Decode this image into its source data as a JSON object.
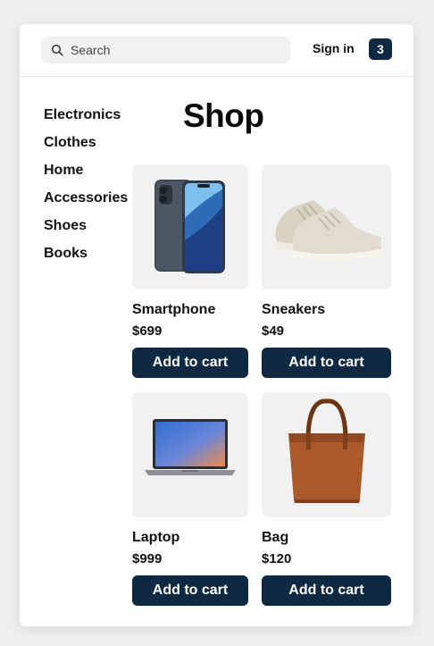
{
  "header": {
    "search": {
      "placeholder": "Search",
      "icon": "search-icon"
    },
    "signin_label": "Sign in",
    "cart_count": "3"
  },
  "page": {
    "title": "Shop"
  },
  "sidebar": {
    "categories": [
      {
        "label": "Electronics"
      },
      {
        "label": "Clothes"
      },
      {
        "label": "Home"
      },
      {
        "label": "Accessories"
      },
      {
        "label": "Shoes"
      },
      {
        "label": "Books"
      }
    ]
  },
  "products": [
    {
      "name": "Smartphone",
      "price": "$699",
      "button_label": "Add to cart",
      "image": "smartphone-image"
    },
    {
      "name": "Sneakers",
      "price": "$49",
      "button_label": "Add to cart",
      "image": "sneakers-image"
    },
    {
      "name": "Laptop",
      "price": "$999",
      "button_label": "Add to cart",
      "image": "laptop-image"
    },
    {
      "name": "Bag",
      "price": "$120",
      "button_label": "Add to cart",
      "image": "bag-image"
    }
  ],
  "colors": {
    "accent": "#0f2942",
    "background": "#f0efed",
    "card": "#ffffff",
    "tile": "#f1f1f1"
  }
}
